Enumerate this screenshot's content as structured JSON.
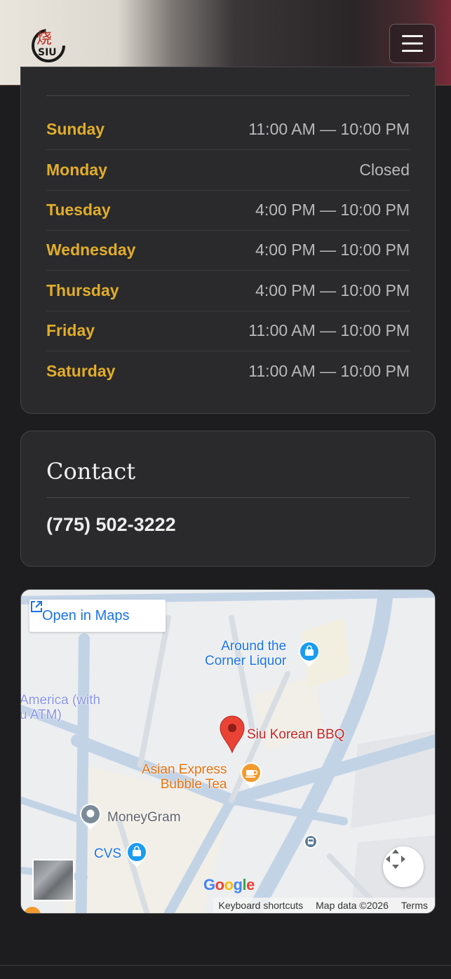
{
  "header": {
    "logo_text": "SIU",
    "logo_glyph": "烧",
    "menu_icon": "hamburger-icon"
  },
  "hours": {
    "rows": [
      {
        "day": "Sunday",
        "time": "11:00 AM — 10:00 PM"
      },
      {
        "day": "Monday",
        "time": "Closed"
      },
      {
        "day": "Tuesday",
        "time": "4:00 PM — 10:00 PM"
      },
      {
        "day": "Wednesday",
        "time": "4:00 PM — 10:00 PM"
      },
      {
        "day": "Thursday",
        "time": "4:00 PM — 10:00 PM"
      },
      {
        "day": "Friday",
        "time": "11:00 AM — 10:00 PM"
      },
      {
        "day": "Saturday",
        "time": "11:00 AM — 10:00 PM"
      }
    ]
  },
  "contact": {
    "title": "Contact",
    "phone": "(775) 502-3222"
  },
  "map": {
    "open_in_maps": "Open in Maps",
    "places": {
      "liquor": "Around the\nCorner Liquor",
      "bank": "America (with\nu ATM)",
      "restaurant": "Siu Korean BBQ",
      "bubble_tea": "Asian Express\nBubble Tea",
      "moneygram": "MoneyGram",
      "cvs": "CVS"
    },
    "google": "Google",
    "keyboard_shortcuts": "Keyboard shortcuts",
    "map_data": "Map data ©2026",
    "terms": "Terms"
  },
  "colors": {
    "accent_gold": "#e1ad2a",
    "card_bg": "#2a2a2c",
    "page_bg": "#1d1d1f",
    "map_pin_red": "#ea4335",
    "map_poi_blue": "#1a73e8"
  }
}
